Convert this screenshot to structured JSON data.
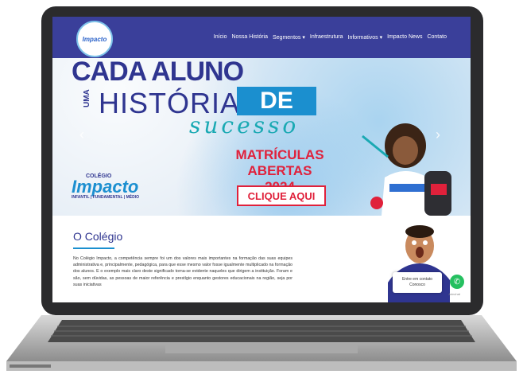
{
  "nav": {
    "logo_text": "Impacto",
    "items": [
      "Início",
      "Nossa História",
      "Segmentos ▾",
      "Infraestrutura",
      "Informativos ▾",
      "Impacto News",
      "Contato"
    ]
  },
  "hero": {
    "headline": "CADA ALUNO",
    "uma": "UMA",
    "historia": "HISTÓRIA",
    "de": "DE",
    "sucesso": "sucesso",
    "matriculas": "MATRÍCULAS ABERTAS 2024",
    "cta": "CLIQUE AQUI",
    "brand_small": "COLÉGIO",
    "brand_name": "Impacto",
    "brand_levels": "INFANTIL | FUNDAMENTAL | MÉDIO",
    "prev_arrow": "‹",
    "next_arrow": "›"
  },
  "section": {
    "title": "O Colégio",
    "paragraph": "No Colégio Impacto, a competência sempre foi um dos valores mais importantes na formação das suas equipes administrativa e, principalmente, pedagógica, para que esse mesmo valor fosse igualmente multiplicado na formação dos alunos. E o exemplo mais claro deste significado torna-se evidente naqueles que dirigem a instituição. Foram e são, sem dúvidas, as pessoas de maior referência e prestígio enquanto gestores educacionais na região, seja por suas iniciativas"
  },
  "chat": {
    "text_line1": "Entre em contato",
    "text_line2": "Conosco",
    "badge": "Joinchat"
  },
  "colors": {
    "nav": "#3a3f9a",
    "brand_blue": "#2f3590",
    "accent_red": "#e0213b",
    "accent_blue": "#1b8fcf",
    "whatsapp": "#25c060"
  }
}
